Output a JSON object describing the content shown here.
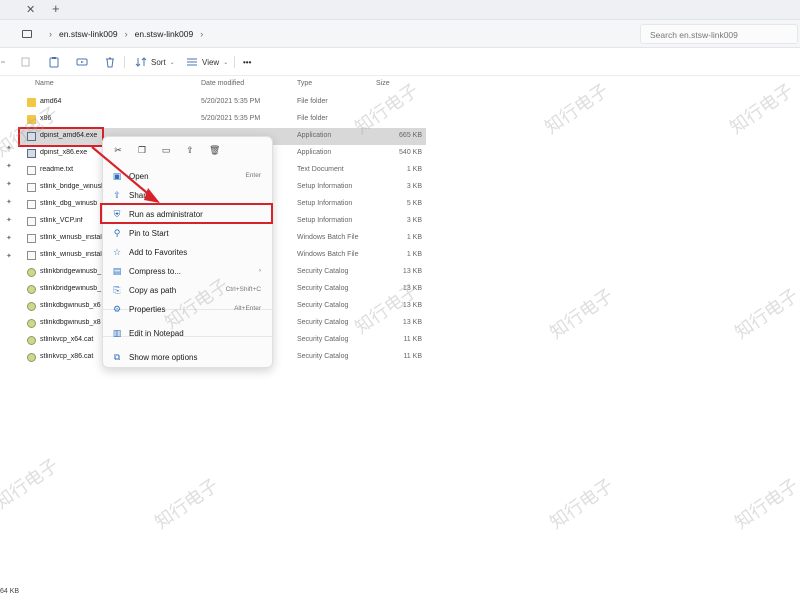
{
  "address": {
    "crumbs": [
      "en.stsw-link009",
      "en.stsw-link009"
    ],
    "search_placeholder": "Search en.stsw-link009"
  },
  "toolbar": {
    "sort_label": "Sort",
    "view_label": "View",
    "more_label": "•••"
  },
  "columns": {
    "name": "Name",
    "date": "Date modified",
    "type": "Type",
    "size": "Size"
  },
  "files": [
    {
      "name": "amd64",
      "date": "5/20/2021 5:35 PM",
      "type": "File folder",
      "size": "",
      "icon": "folder-icon"
    },
    {
      "name": "x86",
      "date": "5/20/2021 5:35 PM",
      "type": "File folder",
      "size": "",
      "icon": "folder-icon"
    },
    {
      "name": "dpinst_amd64.exe",
      "date": "",
      "type": "Application",
      "size": "665 KB",
      "icon": "exe-icon"
    },
    {
      "name": "dpinst_x86.exe",
      "date": "",
      "type": "Application",
      "size": "540 KB",
      "icon": "exe-icon"
    },
    {
      "name": "readme.txt",
      "date": "",
      "type": "Text Document",
      "size": "1 KB",
      "icon": "file-icon"
    },
    {
      "name": "stlink_bridge_winusb",
      "date": "",
      "type": "Setup Information",
      "size": "3 KB",
      "icon": "file-icon"
    },
    {
      "name": "stlink_dbg_winusb",
      "date": "",
      "type": "Setup Information",
      "size": "5 KB",
      "icon": "file-icon"
    },
    {
      "name": "stlink_VCP.inf",
      "date": "",
      "type": "Setup Information",
      "size": "3 KB",
      "icon": "file-icon"
    },
    {
      "name": "stlink_winusb_install",
      "date": "",
      "type": "Windows Batch File",
      "size": "1 KB",
      "icon": "file-icon"
    },
    {
      "name": "stlink_winusb_install",
      "date": "",
      "type": "Windows Batch File",
      "size": "1 KB",
      "icon": "file-icon"
    },
    {
      "name": "stlinkbridgewinusb_",
      "date": "",
      "type": "Security Catalog",
      "size": "13 KB",
      "icon": "catalog-icon"
    },
    {
      "name": "stlinkbridgewinusb_",
      "date": "",
      "type": "Security Catalog",
      "size": "13 KB",
      "icon": "catalog-icon"
    },
    {
      "name": "stlinkdbgwinusb_x6",
      "date": "",
      "type": "Security Catalog",
      "size": "13 KB",
      "icon": "catalog-icon"
    },
    {
      "name": "stlinkdbgwinusb_x8",
      "date": "",
      "type": "Security Catalog",
      "size": "13 KB",
      "icon": "catalog-icon"
    },
    {
      "name": "stlinkvcp_x64.cat",
      "date": "",
      "type": "Security Catalog",
      "size": "11 KB",
      "icon": "catalog-icon"
    },
    {
      "name": "stlinkvcp_x86.cat",
      "date": "",
      "type": "Security Catalog",
      "size": "11 KB",
      "icon": "catalog-icon"
    }
  ],
  "context_menu": {
    "items": [
      {
        "label": "Open",
        "shortcut": "Enter",
        "icon": "open-icon"
      },
      {
        "label": "Share",
        "shortcut": "",
        "icon": "share-icon"
      },
      {
        "label": "Run as administrator",
        "shortcut": "",
        "icon": "shield-icon"
      },
      {
        "label": "Pin to Start",
        "shortcut": "",
        "icon": "pin-icon"
      },
      {
        "label": "Add to Favorites",
        "shortcut": "",
        "icon": "star-icon"
      },
      {
        "label": "Compress to...",
        "shortcut": "",
        "icon": "zip-icon"
      },
      {
        "label": "Copy as path",
        "shortcut": "Ctrl+Shift+C",
        "icon": "copy-path-icon"
      },
      {
        "label": "Properties",
        "shortcut": "Alt+Enter",
        "icon": "wrench-icon"
      },
      {
        "label": "Edit in Notepad",
        "shortcut": "",
        "icon": "notepad-icon"
      },
      {
        "label": "Show more options",
        "shortcut": "",
        "icon": "more-options-icon"
      }
    ]
  },
  "status": {
    "left_text": "64 KB"
  },
  "watermark_text": "知行电子",
  "colors": {
    "highlight": "#d6232a",
    "selection": "#d8d8d8"
  }
}
